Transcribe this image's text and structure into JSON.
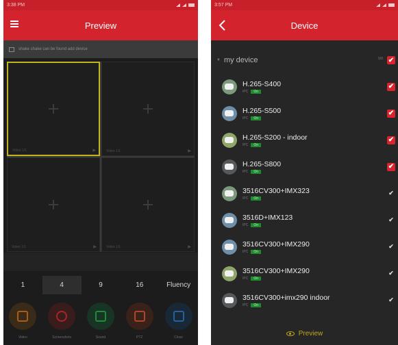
{
  "left": {
    "status": {
      "time": "3:38 PM"
    },
    "title": "Preview",
    "notice": "shake shake can be found add device",
    "cells": [
      {
        "channel": "Video 1/1",
        "selected": true
      },
      {
        "channel": "Video 1/1",
        "selected": false
      },
      {
        "channel": "Video 1/1",
        "selected": false
      },
      {
        "channel": "Video 1/1",
        "selected": false
      }
    ],
    "layouts": [
      "1",
      "4",
      "9",
      "16",
      "Fluency"
    ],
    "active_layout": "4",
    "tools": [
      {
        "icon": "record-icon",
        "label": "Video",
        "color": "#c56a1d",
        "bg": "#3a2a18"
      },
      {
        "icon": "snapshot-icon",
        "label": "Screenshots",
        "color": "#c02b2b",
        "bg": "#3a1c1c"
      },
      {
        "icon": "sound-icon",
        "label": "Sound",
        "color": "#21a23d",
        "bg": "#173424"
      },
      {
        "icon": "ptz-icon",
        "label": "PTZ",
        "color": "#c9532a",
        "bg": "#3a2119"
      },
      {
        "icon": "close-icon",
        "label": "Close",
        "color": "#2c6fb4",
        "bg": "#182837"
      }
    ]
  },
  "right": {
    "status": {
      "time": "3:57 PM"
    },
    "title": "Device",
    "group": {
      "name": "my device",
      "count": "9/9"
    },
    "devices": [
      {
        "name": "H.265-S400",
        "ip": "IPC",
        "status": "On",
        "checked": true
      },
      {
        "name": "H.265-S500",
        "ip": "IPC",
        "status": "On",
        "checked": true
      },
      {
        "name": "H.265-S200 - indoor",
        "ip": "IPC",
        "status": "On",
        "checked": true
      },
      {
        "name": "H.265-S800",
        "ip": "IPC",
        "status": "On",
        "checked": true
      },
      {
        "name": "3516CV300+IMX323",
        "ip": "IPC",
        "status": "On",
        "checked": false
      },
      {
        "name": "3516D+IMX123",
        "ip": "IPC",
        "status": "On",
        "checked": false
      },
      {
        "name": "3516CV300+IMX290",
        "ip": "IPC",
        "status": "On",
        "checked": false
      },
      {
        "name": "3516CV300+IMX290",
        "ip": "IPC",
        "status": "On",
        "checked": false
      },
      {
        "name": "3516CV300+imx290 indoor",
        "ip": "IPC",
        "status": "On",
        "checked": false
      }
    ],
    "preview_label": "Preview"
  },
  "colors": {
    "accent": "#d3242e",
    "selected_border": "#c5b21f",
    "preview": "#c3a51f"
  }
}
